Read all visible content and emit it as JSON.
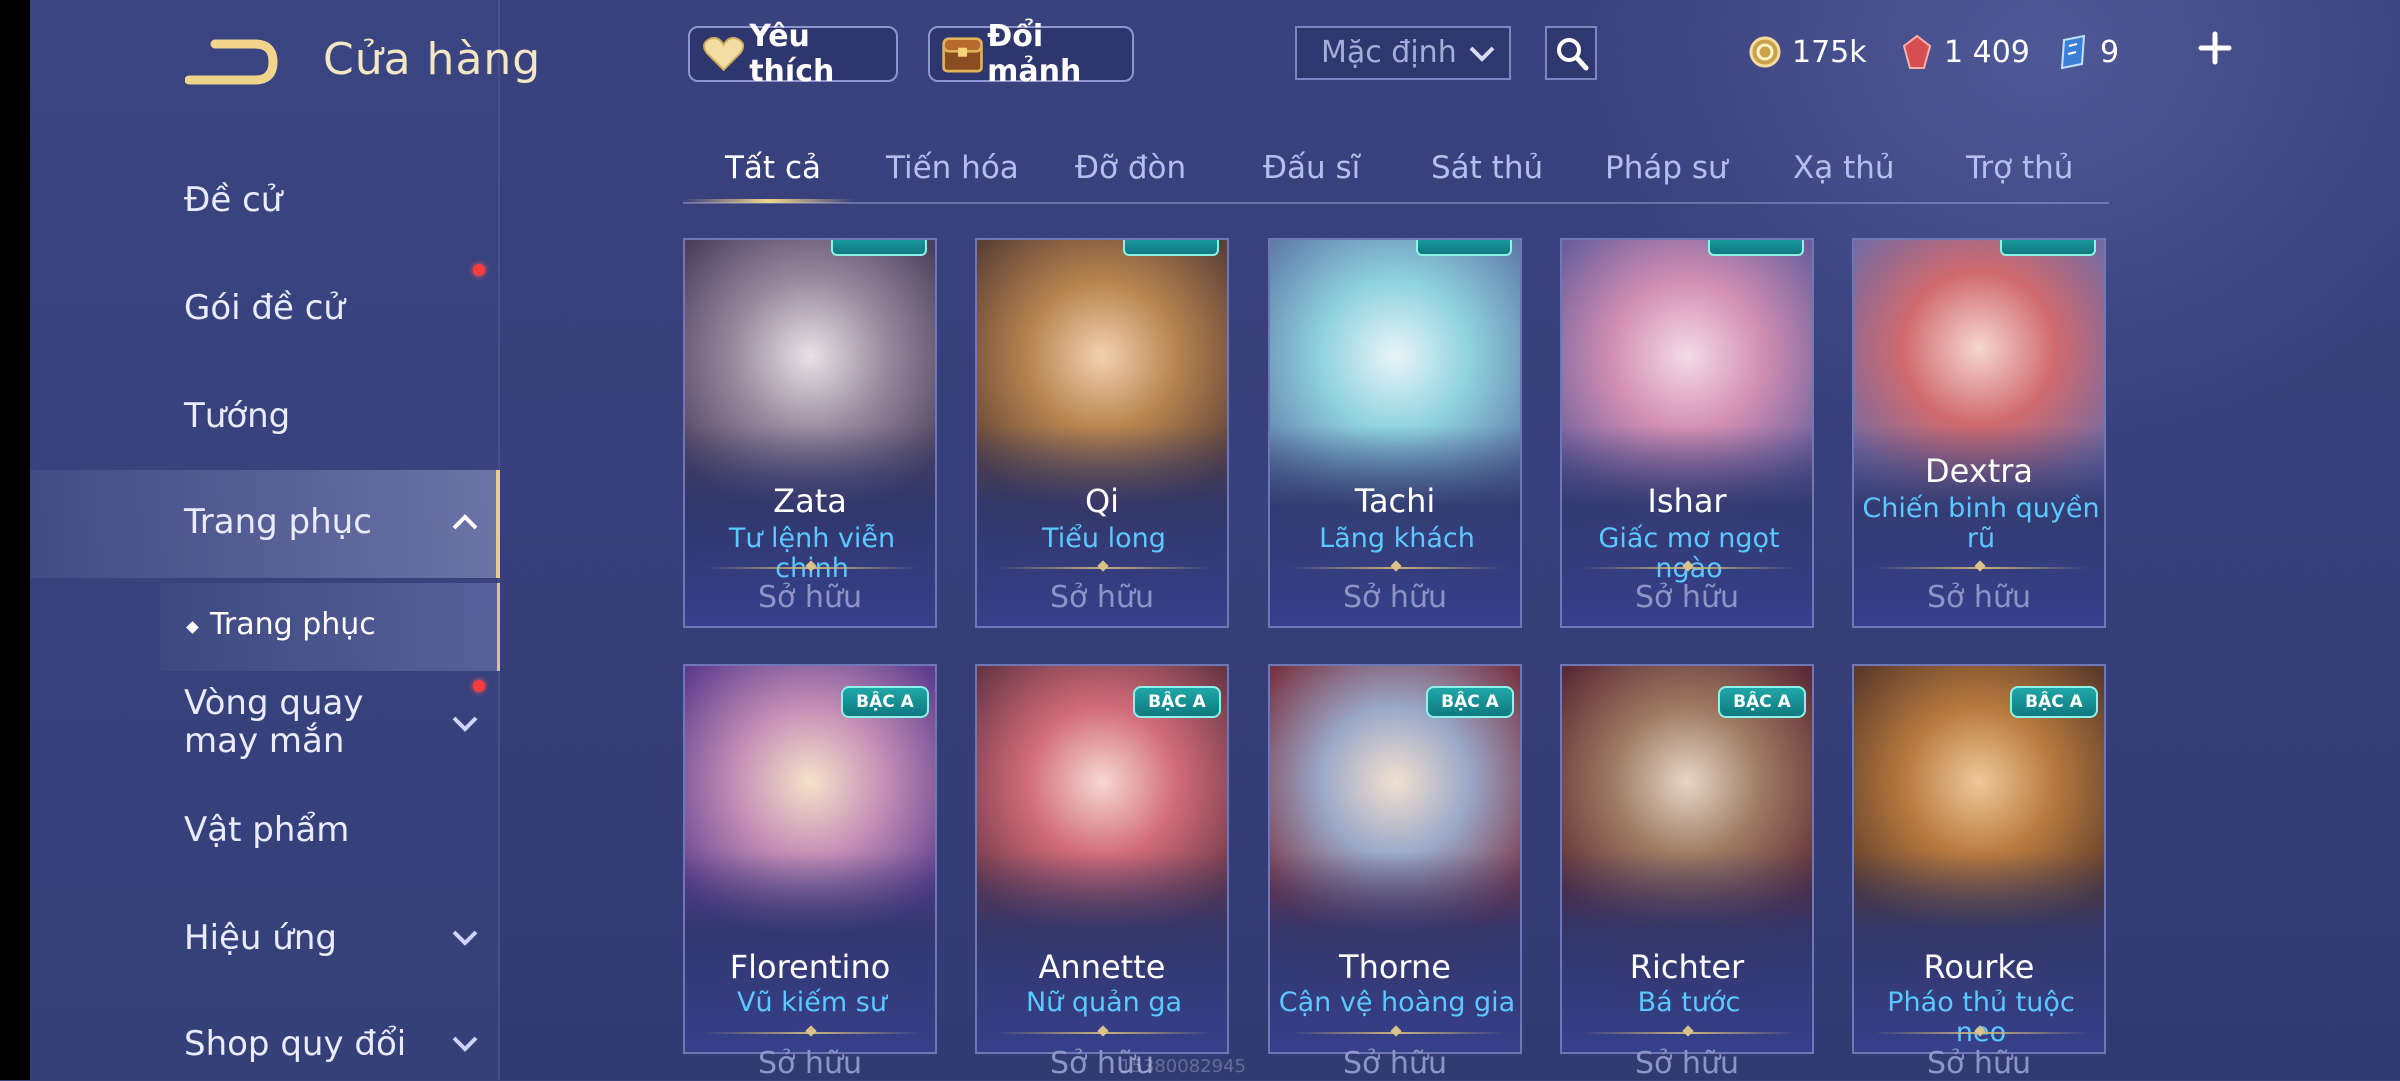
{
  "header": {
    "title": "Cửa hàng",
    "favorites_label": "Yêu thích",
    "exchange_label": "Đổi mảnh",
    "sort_value": "Mặc định",
    "currencies": [
      {
        "name": "gold-coin",
        "value": "175k"
      },
      {
        "name": "red-gem",
        "value": "1 409"
      },
      {
        "name": "blue-voucher",
        "value": "9"
      }
    ]
  },
  "sidebar": {
    "items": [
      {
        "label": "Đề cử"
      },
      {
        "label": "Gói đề cử"
      },
      {
        "label": "Tướng"
      },
      {
        "label": "Trang phục"
      },
      {
        "label": "Vòng quay may mắn"
      },
      {
        "label": "Vật phẩm"
      },
      {
        "label": "Hiệu ứng"
      },
      {
        "label": "Shop quy đổi"
      }
    ],
    "subitem": "Trang phục"
  },
  "tabs": [
    "Tất cả",
    "Tiến hóa",
    "Đỡ đòn",
    "Đấu sĩ",
    "Sát thủ",
    "Pháp sư",
    "Xạ thủ",
    "Trợ thủ"
  ],
  "cards": [
    {
      "hero": "Zata",
      "skin": "Tư lệnh viễn chinh",
      "status": "Sở hữu"
    },
    {
      "hero": "Qi",
      "skin": "Tiểu long",
      "status": "Sở hữu"
    },
    {
      "hero": "Tachi",
      "skin": "Lãng khách",
      "status": "Sở hữu"
    },
    {
      "hero": "Ishar",
      "skin": "Giấc mơ ngọt ngào",
      "status": "Sở hữu"
    },
    {
      "hero": "Dextra",
      "skin": "Chiến binh quyền rũ",
      "status": "Sở hữu"
    },
    {
      "hero": "Florentino",
      "skin": "Vũ kiếm sư",
      "status": "Sở hữu",
      "badge": "BẬC A"
    },
    {
      "hero": "Annette",
      "skin": "Nữ quản ga",
      "status": "Sở hữu",
      "badge": "BẬC A"
    },
    {
      "hero": "Thorne",
      "skin": "Cận vệ hoàng gia",
      "status": "Sở hữu",
      "badge": "BẬC A"
    },
    {
      "hero": "Richter",
      "skin": "Bá tước",
      "status": "Sở hữu",
      "badge": "BẬC A"
    },
    {
      "hero": "Rourke",
      "skin": "Pháo thủ tuộc neo",
      "status": "Sở hữu",
      "badge": "BẬC A"
    }
  ],
  "watermark": "15380082945",
  "colors": {
    "accent_gold": "#e8cd8c",
    "skin_blue": "#5bc8ff",
    "badge_teal": "#1fa7a7",
    "notify_red": "#ff3b3b"
  }
}
